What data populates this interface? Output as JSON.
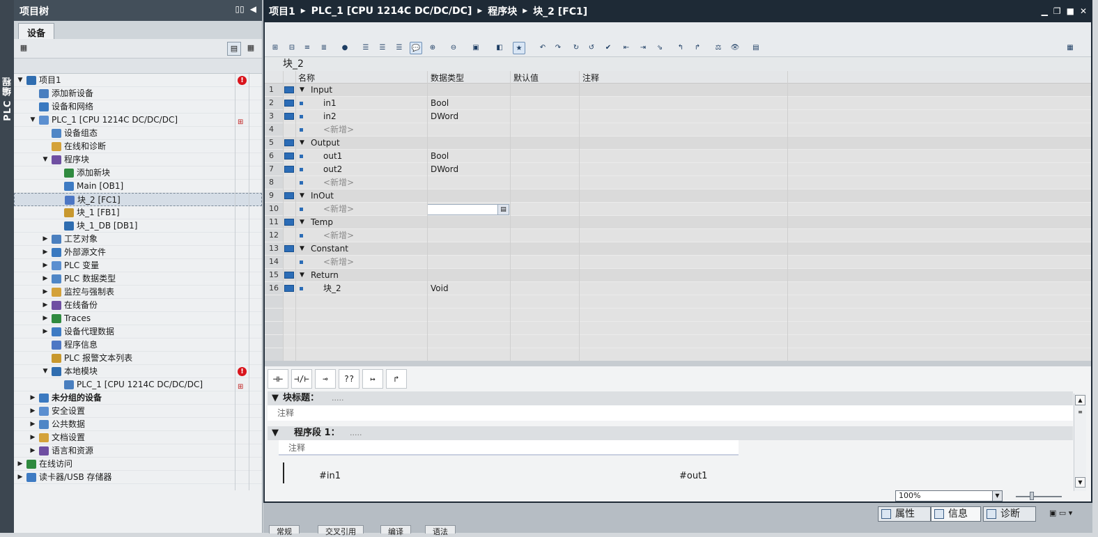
{
  "side_tab": {
    "label": "PLC 编程"
  },
  "project_tree": {
    "title": "项目树",
    "tab": "设备",
    "items": [
      {
        "label": "项目1",
        "level": 0,
        "expand": "open"
      },
      {
        "label": "添加新设备",
        "level": 1,
        "expand": "none"
      },
      {
        "label": "设备和网络",
        "level": 1,
        "expand": "none"
      },
      {
        "label": "PLC_1 [CPU 1214C DC/DC/DC]",
        "level": 1,
        "expand": "open"
      },
      {
        "label": "设备组态",
        "level": 2,
        "expand": "none"
      },
      {
        "label": "在线和诊断",
        "level": 2,
        "expand": "none"
      },
      {
        "label": "程序块",
        "level": 2,
        "expand": "open"
      },
      {
        "label": "添加新块",
        "level": 3,
        "expand": "none"
      },
      {
        "label": "Main [OB1]",
        "level": 3,
        "expand": "none"
      },
      {
        "label": "块_2 [FC1]",
        "level": 3,
        "expand": "none"
      },
      {
        "label": "块_1 [FB1]",
        "level": 3,
        "expand": "none"
      },
      {
        "label": "块_1_DB [DB1]",
        "level": 3,
        "expand": "none"
      },
      {
        "label": "工艺对象",
        "level": 2,
        "expand": "closed"
      },
      {
        "label": "外部源文件",
        "level": 2,
        "expand": "closed"
      },
      {
        "label": "PLC 变量",
        "level": 2,
        "expand": "closed"
      },
      {
        "label": "PLC 数据类型",
        "level": 2,
        "expand": "closed"
      },
      {
        "label": "监控与强制表",
        "level": 2,
        "expand": "closed"
      },
      {
        "label": "在线备份",
        "level": 2,
        "expand": "closed"
      },
      {
        "label": "Traces",
        "level": 2,
        "expand": "closed"
      },
      {
        "label": "设备代理数据",
        "level": 2,
        "expand": "closed"
      },
      {
        "label": "程序信息",
        "level": 2,
        "expand": "none"
      },
      {
        "label": "PLC 报警文本列表",
        "level": 2,
        "expand": "none"
      },
      {
        "label": "本地模块",
        "level": 2,
        "expand": "open"
      },
      {
        "label": "PLC_1 [CPU 1214C DC/DC/DC]",
        "level": 3,
        "expand": "none"
      },
      {
        "label": "未分组的设备",
        "level": 1,
        "expand": "closed"
      },
      {
        "label": "安全设置",
        "level": 1,
        "expand": "closed"
      },
      {
        "label": "公共数据",
        "level": 1,
        "expand": "closed"
      },
      {
        "label": "文档设置",
        "level": 1,
        "expand": "closed"
      },
      {
        "label": "语言和资源",
        "level": 1,
        "expand": "closed"
      },
      {
        "label": "在线访问",
        "level": 0,
        "expand": "closed"
      },
      {
        "label": "读卡器/USB 存储器",
        "level": 0,
        "expand": "closed"
      }
    ]
  },
  "editor": {
    "breadcrumb": [
      "项目1",
      "PLC_1 [CPU 1214C DC/DC/DC]",
      "程序块",
      "块_2 [FC1]"
    ],
    "block_name": "块_2",
    "columns": {
      "name": "名称",
      "datatype": "数据类型",
      "default": "默认值",
      "comment": "注释"
    },
    "rows": [
      {
        "num": "1",
        "name": "Input",
        "type": "",
        "section": true
      },
      {
        "num": "2",
        "name": "in1",
        "type": "Bool",
        "section": false
      },
      {
        "num": "3",
        "name": "in2",
        "type": "DWord",
        "section": false
      },
      {
        "num": "4",
        "name": "<新增>",
        "type": "",
        "section": false,
        "new": true
      },
      {
        "num": "5",
        "name": "Output",
        "type": "",
        "section": true
      },
      {
        "num": "6",
        "name": "out1",
        "type": "Bool",
        "section": false
      },
      {
        "num": "7",
        "name": "out2",
        "type": "DWord",
        "section": false
      },
      {
        "num": "8",
        "name": "<新增>",
        "type": "",
        "section": false,
        "new": true
      },
      {
        "num": "9",
        "name": "InOut",
        "type": "",
        "section": true
      },
      {
        "num": "10",
        "name": "<新增>",
        "type": "",
        "section": false,
        "new": true
      },
      {
        "num": "11",
        "name": "Temp",
        "type": "",
        "section": true
      },
      {
        "num": "12",
        "name": "<新增>",
        "type": "",
        "section": false,
        "new": true
      },
      {
        "num": "13",
        "name": "Constant",
        "type": "",
        "section": true
      },
      {
        "num": "14",
        "name": "<新增>",
        "type": "",
        "section": false,
        "new": true
      },
      {
        "num": "15",
        "name": "Return",
        "type": "",
        "section": true
      },
      {
        "num": "16",
        "name": "块_2",
        "type": "Void",
        "section": false
      }
    ],
    "lad_buttons": [
      "⊣⊢",
      "⊣/⊢",
      "⊸",
      "??",
      "↦",
      "↱"
    ],
    "block_title": {
      "label": "块标题：",
      "dots": ".....",
      "comment": "注释"
    },
    "network": {
      "label": "程序段 1：",
      "dots": ".....",
      "comment": "注释"
    },
    "operands": {
      "in": "#in1",
      "out": "#out1"
    },
    "zoom": "100%"
  },
  "bottom_panel": {
    "tabs": [
      "属性",
      "信息",
      "诊断"
    ],
    "subtabs": [
      "常规",
      "交叉引用",
      "编译",
      "语法"
    ]
  }
}
